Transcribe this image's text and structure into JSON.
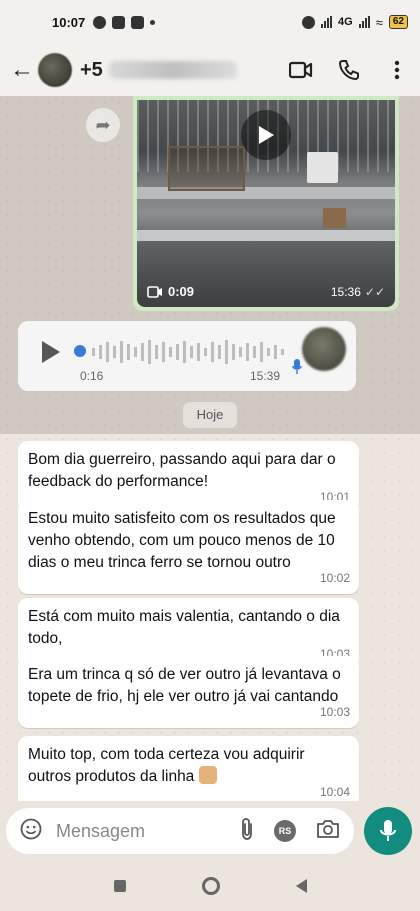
{
  "status_bar": {
    "time": "10:07",
    "battery": "62",
    "network": "4G"
  },
  "header": {
    "contact_prefix": "+5",
    "icons": [
      "back-arrow-icon",
      "video-call-icon",
      "phone-icon",
      "more-vert-icon"
    ]
  },
  "chat": {
    "video": {
      "duration": "0:09",
      "time": "15:36"
    },
    "voice": {
      "elapsed": "0:16",
      "time": "15:39"
    },
    "date_separator": "Hoje",
    "messages": [
      {
        "text": "Bom dia guerreiro, passando aqui para dar o feedback do performance!",
        "time": "10:01"
      },
      {
        "text": "Estou muito satisfeito com os resultados que venho obtendo, com um pouco menos de 10 dias o meu trinca ferro se tornou outro",
        "time": "10:02"
      },
      {
        "text": "Está com muito mais valentia, cantando o dia todo,",
        "time": "10:03"
      },
      {
        "text": "Era um trinca q só de ver outro já levantava o topete de frio, hj ele ver outro já vai cantando",
        "time": "10:03"
      },
      {
        "text": "Muito top, com toda certeza vou adquirir outros produtos da linha",
        "time": "10:04",
        "emoji": "flexed-biceps-emoji"
      }
    ]
  },
  "input": {
    "placeholder": "Mensagem",
    "rs_label": "RS"
  },
  "colors": {
    "accent": "#128c7e",
    "chat_bg": "#ece5dd",
    "video_bubble": "#cfe9c0"
  }
}
